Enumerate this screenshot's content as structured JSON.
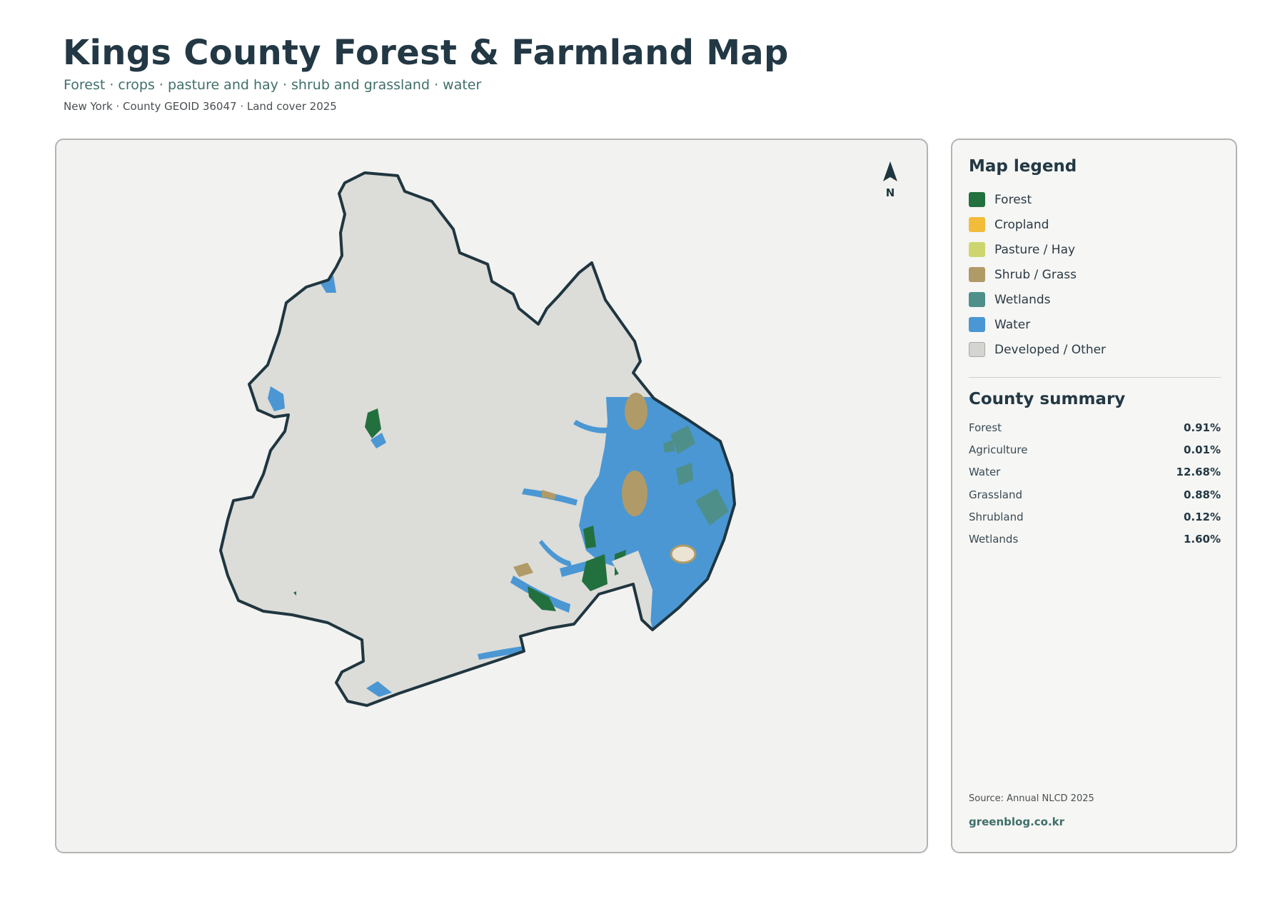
{
  "header": {
    "title": "Kings County Forest & Farmland Map",
    "subtitle": "Forest · crops · pasture and hay · shrub and grassland · water",
    "meta": "New York · County GEOID 36047 · Land cover 2025"
  },
  "map": {
    "north_label": "N",
    "north_arrow_icon": "north-arrow-icon",
    "colors": {
      "forest": "#23703f",
      "cropland": "#f0bc3a",
      "pasture": "#cdd66e",
      "shrub": "#b09a67",
      "wetlands": "#4e8f8a",
      "water": "#4a97d4",
      "developed": "#dcdcd8",
      "outline": "#1f3640",
      "background": "#f2f2f0"
    }
  },
  "legend": {
    "heading": "Map legend",
    "items": [
      {
        "label": "Forest",
        "color": "#23703f"
      },
      {
        "label": "Cropland",
        "color": "#f0bc3a"
      },
      {
        "label": "Pasture / Hay",
        "color": "#cdd66e"
      },
      {
        "label": "Shrub / Grass",
        "color": "#b09a67"
      },
      {
        "label": "Wetlands",
        "color": "#4e8f8a"
      },
      {
        "label": "Water",
        "color": "#4a97d4"
      },
      {
        "label": "Developed / Other",
        "color": "#d4d4d0"
      }
    ]
  },
  "summary": {
    "heading": "County summary",
    "rows": [
      {
        "name": "Forest",
        "value": "0.91%"
      },
      {
        "name": "Agriculture",
        "value": "0.01%"
      },
      {
        "name": "Water",
        "value": "12.68%"
      },
      {
        "name": "Grassland",
        "value": "0.88%"
      },
      {
        "name": "Shrubland",
        "value": "0.12%"
      },
      {
        "name": "Wetlands",
        "value": "1.60%"
      }
    ]
  },
  "footer": {
    "source": "Source: Annual NLCD 2025",
    "site": "greenblog.co.kr"
  }
}
